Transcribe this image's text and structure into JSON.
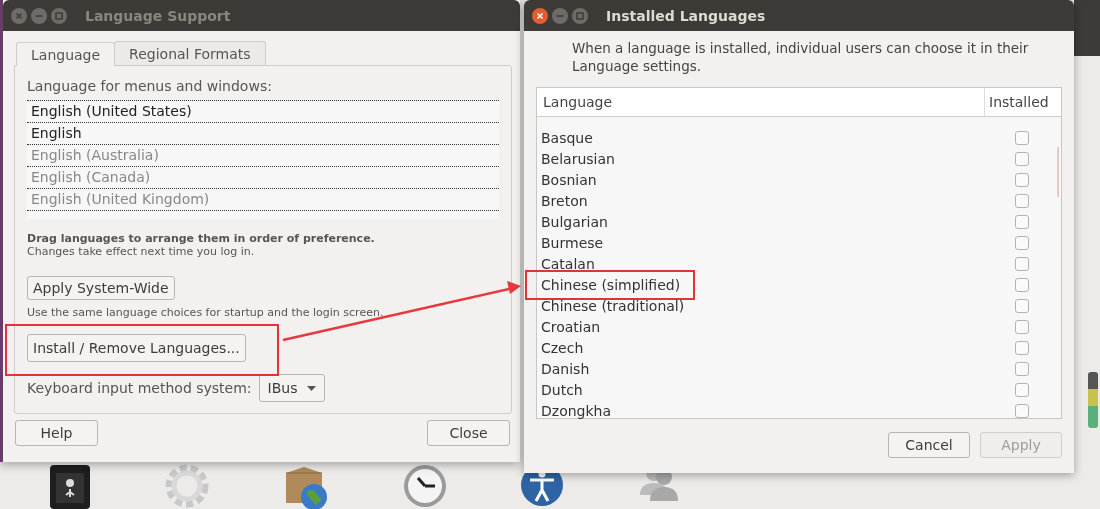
{
  "language_support": {
    "title": "Language Support",
    "active": false,
    "tabs": [
      {
        "label": "Language",
        "selected": true
      },
      {
        "label": "Regional Formats",
        "selected": false
      }
    ],
    "list_label": "Language for menus and windows:",
    "languages": [
      {
        "name": "English (United States)",
        "dimmed": false
      },
      {
        "name": "English",
        "dimmed": false
      },
      {
        "name": "English (Australia)",
        "dimmed": true
      },
      {
        "name": "English (Canada)",
        "dimmed": true
      },
      {
        "name": "English (United Kingdom)",
        "dimmed": true
      }
    ],
    "drag_hint": "Drag languages to arrange them in order of preference.",
    "change_hint": "Changes take effect next time you log in.",
    "apply_button": "Apply System-Wide",
    "apply_hint": "Use the same language choices for startup and the login screen.",
    "install_button": {
      "label": "Install / Remove Languages...",
      "highlighted": true
    },
    "input_method": {
      "label": "Keyboard input method system:",
      "value": "IBus"
    },
    "buttons": [
      "Help",
      "Close"
    ]
  },
  "installed_languages": {
    "title": "Installed Languages",
    "active": true,
    "description": "When a language is installed, individual users can choose it in their Language settings.",
    "columns": [
      "Language",
      "Installed"
    ],
    "rows": [
      {
        "name": "Basque",
        "checked": false,
        "highlighted": false
      },
      {
        "name": "Belarusian",
        "checked": false,
        "highlighted": false
      },
      {
        "name": "Bosnian",
        "checked": false,
        "highlighted": false
      },
      {
        "name": "Breton",
        "checked": false,
        "highlighted": false
      },
      {
        "name": "Bulgarian",
        "checked": false,
        "highlighted": false
      },
      {
        "name": "Burmese",
        "checked": false,
        "highlighted": false
      },
      {
        "name": "Catalan",
        "checked": false,
        "highlighted": false
      },
      {
        "name": "Chinese (simplified)",
        "checked": false,
        "highlighted": true
      },
      {
        "name": "Chinese (traditional)",
        "checked": false,
        "highlighted": false
      },
      {
        "name": "Croatian",
        "checked": false,
        "highlighted": false
      },
      {
        "name": "Czech",
        "checked": false,
        "highlighted": false
      },
      {
        "name": "Danish",
        "checked": false,
        "highlighted": false
      },
      {
        "name": "Dutch",
        "checked": false,
        "highlighted": false
      },
      {
        "name": "Dzongkha",
        "checked": false,
        "highlighted": false
      }
    ],
    "buttons": [
      {
        "label": "Cancel",
        "disabled": false
      },
      {
        "label": "Apply",
        "disabled": true
      }
    ]
  }
}
